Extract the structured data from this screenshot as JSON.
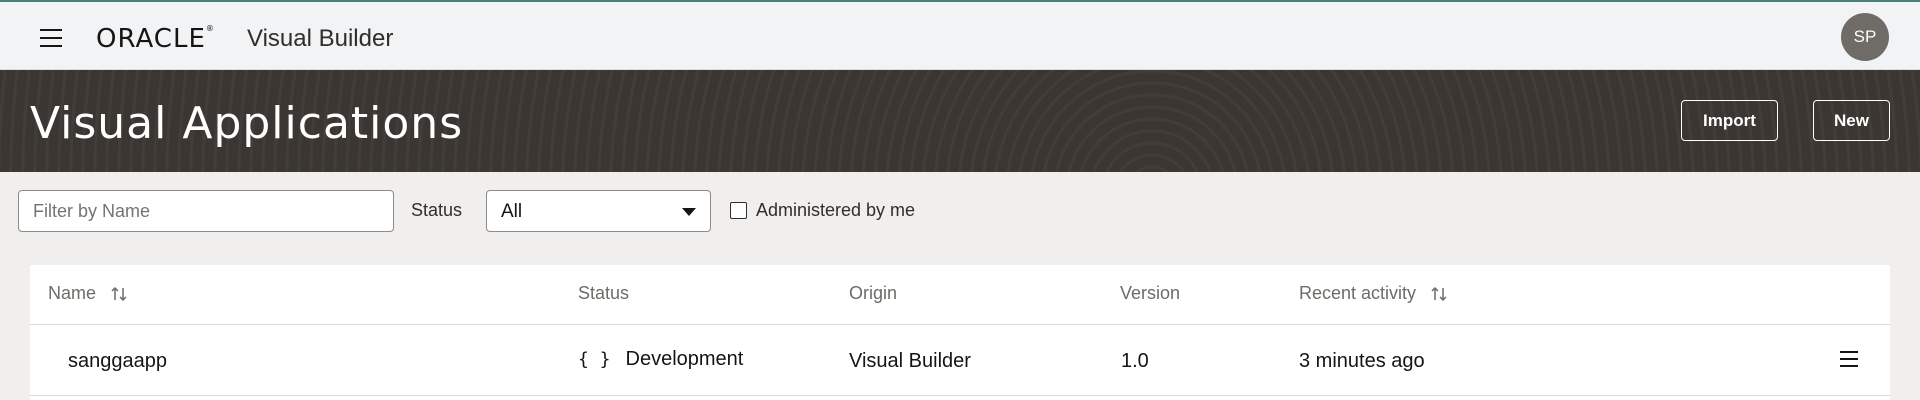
{
  "app": {
    "brand": "ORACLE",
    "product": "Visual Builder",
    "avatar_initials": "SP"
  },
  "banner": {
    "title": "Visual Applications",
    "import_label": "Import",
    "new_label": "New"
  },
  "filters": {
    "name_placeholder": "Filter by Name",
    "name_value": "",
    "status_label": "Status",
    "status_selected": "All",
    "admin_checkbox_label": "Administered by me",
    "admin_checked": false
  },
  "table": {
    "columns": {
      "name": "Name",
      "status": "Status",
      "origin": "Origin",
      "version": "Version",
      "recent_activity": "Recent activity"
    },
    "rows": [
      {
        "name": "sanggaapp",
        "status_icon": "{ }",
        "status": "Development",
        "origin": "Visual Builder",
        "version": "1.0",
        "recent_activity": "3 minutes ago"
      }
    ]
  },
  "colors": {
    "top_accent": "#4a7f7a",
    "banner_bg": "#3b3632",
    "page_bg": "#f1efed",
    "avatar_bg": "#6f6b67"
  }
}
